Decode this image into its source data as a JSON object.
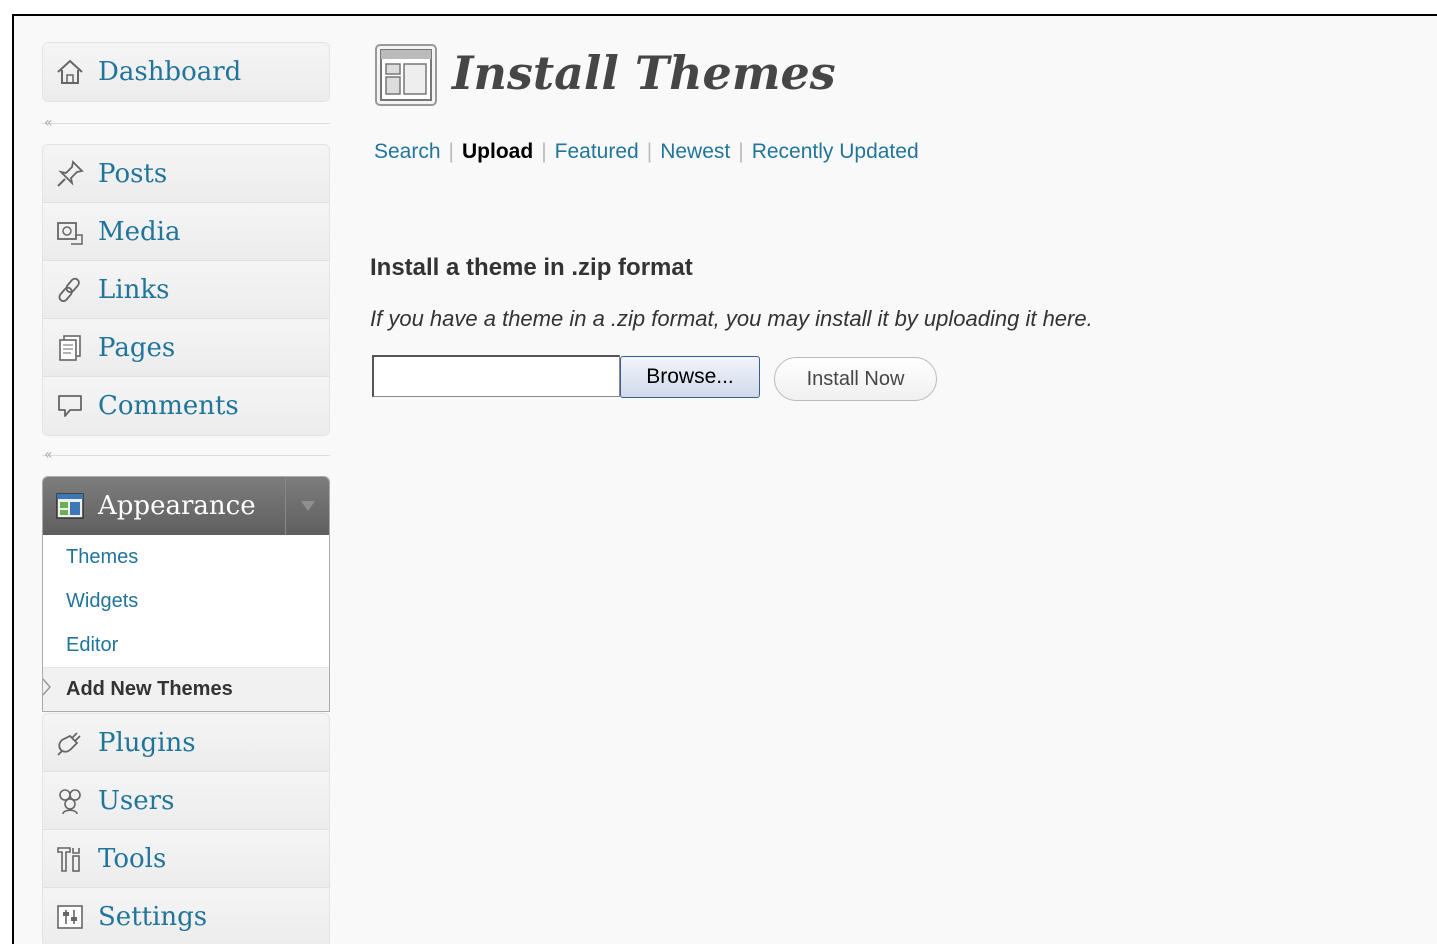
{
  "sidebar": {
    "top": [
      {
        "label": "Dashboard",
        "icon": "dashboard-icon"
      }
    ],
    "content": [
      {
        "label": "Posts",
        "icon": "pushpin-icon"
      },
      {
        "label": "Media",
        "icon": "media-icon"
      },
      {
        "label": "Links",
        "icon": "link-icon"
      },
      {
        "label": "Pages",
        "icon": "pages-icon"
      },
      {
        "label": "Comments",
        "icon": "comment-icon"
      }
    ],
    "collapse_glyph": "«",
    "appearance": {
      "label": "Appearance",
      "icon": "appearance-icon",
      "toggle_icon": "triangle-down-icon",
      "subitems": [
        {
          "label": "Themes"
        },
        {
          "label": "Widgets"
        },
        {
          "label": "Editor"
        },
        {
          "label": "Add New Themes",
          "current": true
        }
      ]
    },
    "admin": [
      {
        "label": "Plugins",
        "icon": "plug-icon"
      },
      {
        "label": "Users",
        "icon": "users-icon"
      },
      {
        "label": "Tools",
        "icon": "tools-icon"
      },
      {
        "label": "Settings",
        "icon": "settings-icon"
      }
    ]
  },
  "main": {
    "title": "Install Themes",
    "title_icon": "appearance-page-icon",
    "subnav": [
      {
        "label": "Search"
      },
      {
        "label": "Upload",
        "current": true
      },
      {
        "label": "Featured"
      },
      {
        "label": "Newest"
      },
      {
        "label": "Recently Updated"
      }
    ],
    "subnav_separator": "|",
    "section_title": "Install a theme in .zip format",
    "section_description": "If you have a theme in a .zip format, you may install it by uploading it here.",
    "file_input_value": "",
    "browse_label": "Browse...",
    "install_label": "Install Now"
  },
  "colors": {
    "link": "#21759b",
    "background": "#f9f9f9",
    "appearance_head": "#6d6d6d"
  }
}
